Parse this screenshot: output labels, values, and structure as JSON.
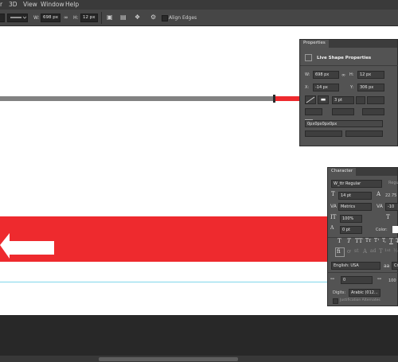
{
  "menubar": {
    "items": [
      "r",
      "3D",
      "View",
      "Window",
      "Help"
    ]
  },
  "options": {
    "w_label": "W:",
    "w_value": "698 px",
    "h_label": "H:",
    "h_value": "12 px",
    "align_edges": "Align Edges"
  },
  "properties": {
    "tab": "Properties",
    "section_title": "Live Shape Properties",
    "w_label": "W:",
    "w_value": "698 px",
    "h_label": "H:",
    "h_value": "12 px",
    "x_label": "X:",
    "x_value": "-14 px",
    "y_label": "Y:",
    "y_value": "306 px",
    "stroke_width": "3 pt",
    "corner_value": "0px0px0px0px"
  },
  "character": {
    "tab": "Character",
    "font_family": "W_ttr Regular",
    "font_style": "Regu",
    "font_size": "14 pt",
    "leading": "22.75",
    "kerning": "Metrics",
    "tracking": "-10",
    "vertical_scale": "100%",
    "baseline_shift": "0 pt",
    "color_label": "Color:",
    "language": "English: USA",
    "antialias": "aa",
    "antialias_value": "Cr",
    "spacing_value": "0",
    "spacing_value_2": "100",
    "digits_label": "Digits:",
    "digits_value": "Arabic (012...",
    "justification_alternates": "Justification Alternates",
    "type_style_buttons": [
      "T",
      "T",
      "TT",
      "Tт",
      "T¹",
      "T,",
      "T",
      "T̶"
    ],
    "opentype_buttons": [
      "fi",
      "ơ",
      "st",
      "A",
      "ad",
      "T",
      "1st",
      "½"
    ]
  },
  "colors": {
    "red": "#ee2a2e",
    "panel": "#535353",
    "guide": "#7fd6ea"
  }
}
